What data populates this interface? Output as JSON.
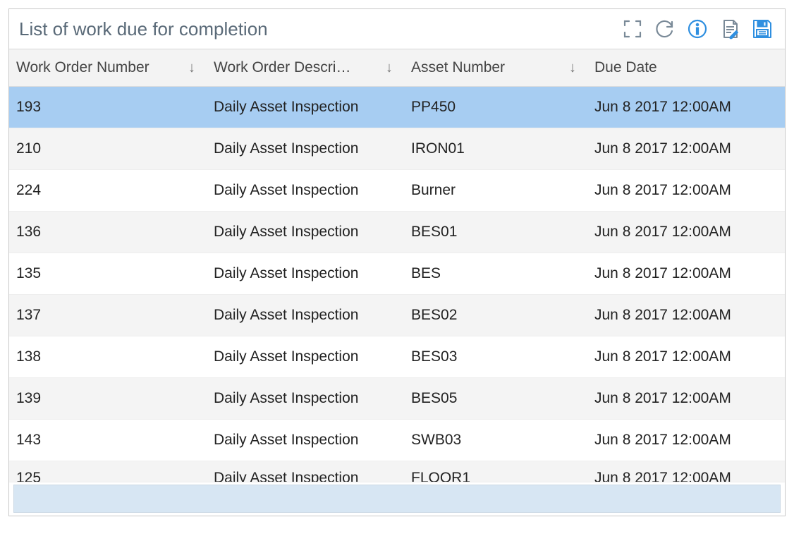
{
  "header": {
    "title": "List of work due for completion"
  },
  "columns": [
    {
      "label": "Work Order Number",
      "sortable": true
    },
    {
      "label": "Work Order Descri…",
      "sortable": true
    },
    {
      "label": "Asset Number",
      "sortable": true
    },
    {
      "label": "Due Date",
      "sortable": false
    }
  ],
  "rows": [
    {
      "num": "193",
      "desc": "Daily Asset Inspection",
      "asset": "PP450",
      "due": "Jun 8 2017 12:00AM",
      "selected": true
    },
    {
      "num": "210",
      "desc": "Daily Asset Inspection",
      "asset": "IRON01",
      "due": "Jun 8 2017 12:00AM"
    },
    {
      "num": "224",
      "desc": "Daily Asset Inspection",
      "asset": "Burner",
      "due": "Jun 8 2017 12:00AM"
    },
    {
      "num": "136",
      "desc": "Daily Asset Inspection",
      "asset": "BES01",
      "due": "Jun 8 2017 12:00AM"
    },
    {
      "num": "135",
      "desc": "Daily Asset Inspection",
      "asset": "BES",
      "due": "Jun 8 2017 12:00AM"
    },
    {
      "num": "137",
      "desc": "Daily Asset Inspection",
      "asset": "BES02",
      "due": "Jun 8 2017 12:00AM"
    },
    {
      "num": "138",
      "desc": "Daily Asset Inspection",
      "asset": "BES03",
      "due": "Jun 8 2017 12:00AM"
    },
    {
      "num": "139",
      "desc": "Daily Asset Inspection",
      "asset": "BES05",
      "due": "Jun 8 2017 12:00AM"
    },
    {
      "num": "143",
      "desc": "Daily Asset Inspection",
      "asset": "SWB03",
      "due": "Jun 8 2017 12:00AM"
    },
    {
      "num": "125",
      "desc": "Daily Asset Inspection",
      "asset": "FLOOR1",
      "due": "Jun 8 2017 12:00AM",
      "partial": true
    }
  ]
}
